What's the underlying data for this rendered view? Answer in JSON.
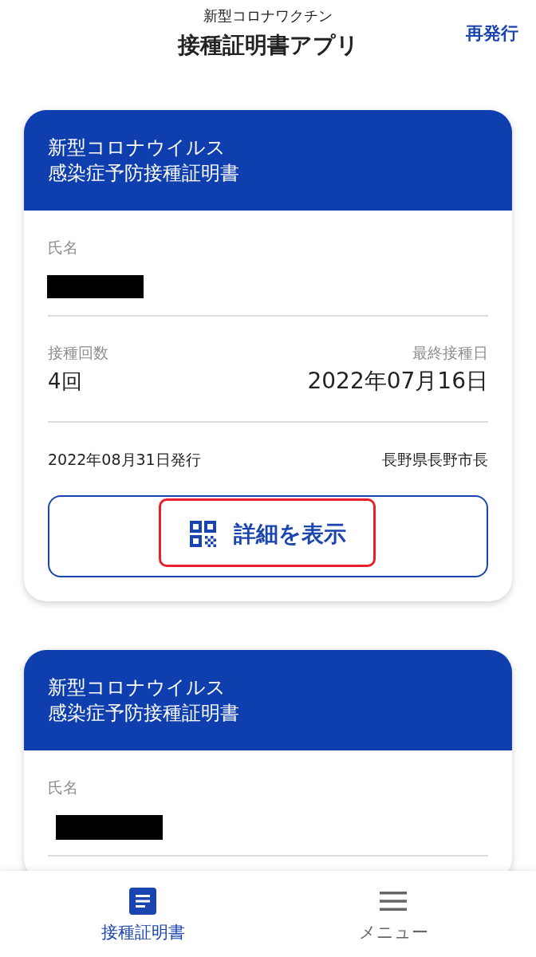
{
  "header": {
    "subtitle": "新型コロナワクチン",
    "title": "接種証明書アプリ",
    "action": "再発行"
  },
  "certificates": [
    {
      "title_lines": [
        "新型コロナウイルス",
        "感染症予防接種証明書"
      ],
      "name_label": "氏名",
      "name_redacted": true,
      "dose_count_label": "接種回数",
      "dose_count": "4回",
      "last_dose_label": "最終接種日",
      "last_dose_date": "2022年07月16日",
      "issued": "2022年08月31日発行",
      "issuer": "長野県長野市長",
      "button": {
        "label": "詳細を表示",
        "highlighted": true
      }
    },
    {
      "title_lines": [
        "新型コロナウイルス",
        "感染症予防接種証明書"
      ],
      "name_label": "氏名",
      "name_redacted": true
    }
  ],
  "bottom_nav": [
    {
      "label": "接種証明書",
      "selected": true
    },
    {
      "label": "メニュー",
      "selected": false
    }
  ]
}
